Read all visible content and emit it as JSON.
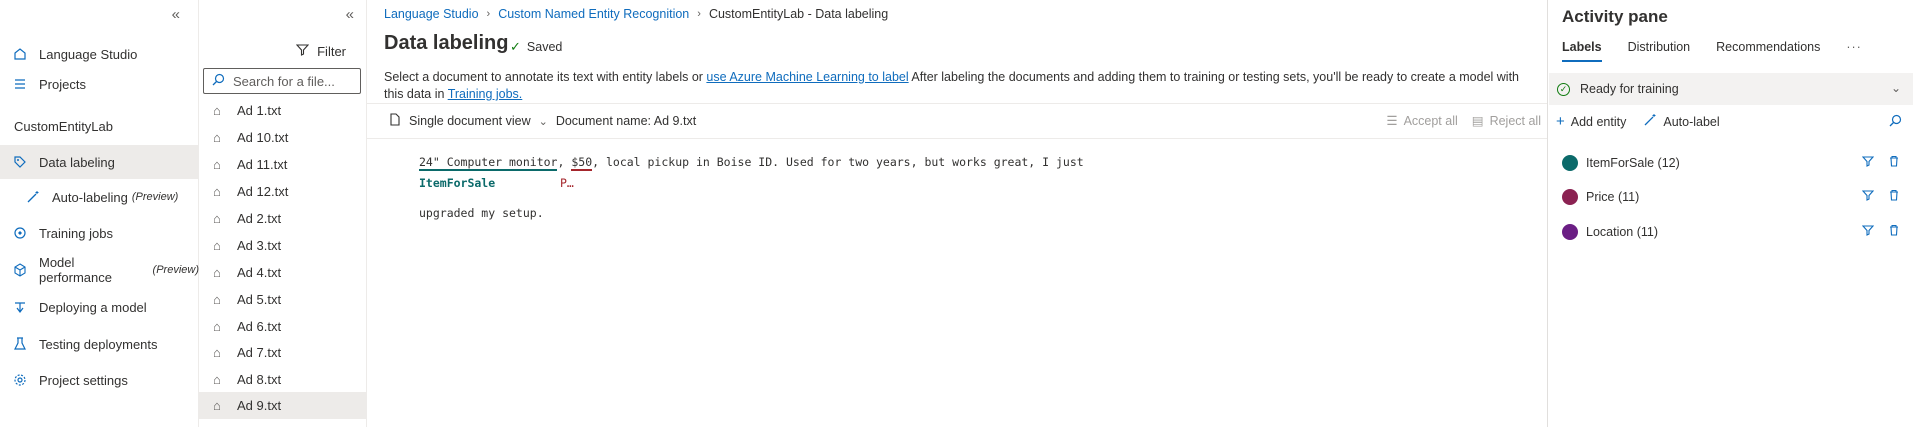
{
  "leftnav": {
    "items": [
      {
        "label": "Language Studio"
      },
      {
        "label": "Projects"
      },
      {
        "label": "Data labeling"
      },
      {
        "label": "Auto-labeling",
        "badge": "(Preview)"
      },
      {
        "label": "Training jobs"
      },
      {
        "label": "Model performance",
        "badge": "(Preview)"
      },
      {
        "label": "Deploying a model"
      },
      {
        "label": "Testing deployments"
      },
      {
        "label": "Project settings"
      }
    ],
    "project_name": "CustomEntityLab"
  },
  "doclist": {
    "filter_label": "Filter",
    "search_placeholder": "Search for a file...",
    "files": [
      "Ad 1.txt",
      "Ad 10.txt",
      "Ad 11.txt",
      "Ad 12.txt",
      "Ad 2.txt",
      "Ad 3.txt",
      "Ad 4.txt",
      "Ad 5.txt",
      "Ad 6.txt",
      "Ad 7.txt",
      "Ad 8.txt",
      "Ad 9.txt"
    ],
    "selected": "Ad 9.txt"
  },
  "breadcrumb": [
    "Language Studio",
    "Custom Named Entity Recognition",
    "CustomEntityLab - Data labeling"
  ],
  "page": {
    "title": "Data labeling",
    "status": "Saved",
    "desc_pre": "Select a document to annotate its text with entity labels or ",
    "desc_link": "use Azure Machine Learning to label",
    "desc_post": "  After labeling the documents and adding them to training or testing sets, you'll be ready to create a model with this data in ",
    "desc_link2": "Training jobs."
  },
  "toolbar": {
    "view_mode": "Single document view",
    "document_name": "Document name: Ad 9.txt",
    "accept_all": "Accept all",
    "reject_all": "Reject all"
  },
  "document": {
    "entity1_text": "24\" Computer monitor",
    "sep1": ", ",
    "entity2_text": "$50",
    "rest_line1": ", local pickup in Boise ID. Used for two years, but works great, I just",
    "entity1_label": "ItemForSale",
    "entity2_label": "P…",
    "line2": "upgraded my setup."
  },
  "activity": {
    "title": "Activity pane",
    "tabs": [
      "Labels",
      "Distribution",
      "Recommendations",
      "···"
    ],
    "ready": "Ready for training",
    "add_entity": "Add entity",
    "auto_label": "Auto-label",
    "entities": [
      {
        "label": "ItemForSale (12)",
        "color": "#0b6a6a"
      },
      {
        "label": "Price (11)",
        "color": "#8b2252"
      },
      {
        "label": "Location (11)",
        "color": "#6b1e84"
      }
    ]
  },
  "icons": {
    "collapse": "double-chevron-left-icon",
    "filter": "filter-icon",
    "search": "search-icon",
    "tag": "tag-icon",
    "check": "checkmark-icon",
    "funnel": "funnel-icon",
    "delete": "trash-icon"
  }
}
